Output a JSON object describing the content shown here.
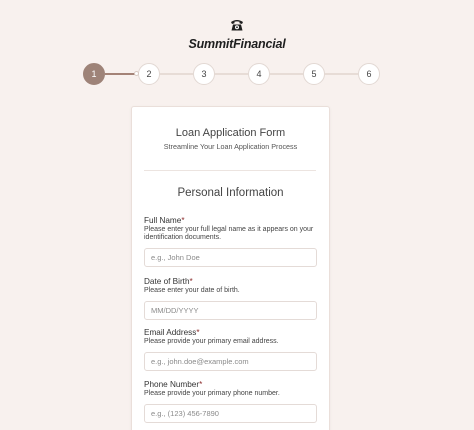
{
  "brand": {
    "icon": "telephone-icon",
    "name": "SummitFinancial"
  },
  "stepper": {
    "steps": [
      "1",
      "2",
      "3",
      "4",
      "5",
      "6"
    ],
    "current_step": 1,
    "active_color": "#9e8378"
  },
  "form": {
    "title": "Loan Application Form",
    "subtitle": "Streamline Your Loan Application Process",
    "section_title": "Personal Information",
    "fields": [
      {
        "label": "Full Name",
        "required_mark": "*",
        "help": "Please enter your full legal name as it appears on your identification documents.",
        "placeholder": "e.g., John Doe",
        "value": ""
      },
      {
        "label": "Date of Birth",
        "required_mark": "*",
        "help": "Please enter your date of birth.",
        "placeholder": "MM/DD/YYYY",
        "value": ""
      },
      {
        "label": "Email Address",
        "required_mark": "*",
        "help": "Please provide your primary email address.",
        "placeholder": "e.g., john.doe@example.com",
        "value": ""
      },
      {
        "label": "Phone Number",
        "required_mark": "*",
        "help": "Please provide your primary phone number.",
        "placeholder": "e.g., (123) 456-7890",
        "value": ""
      }
    ]
  },
  "colors": {
    "background": "#f8f1ee",
    "required": "#8c2d2d"
  }
}
